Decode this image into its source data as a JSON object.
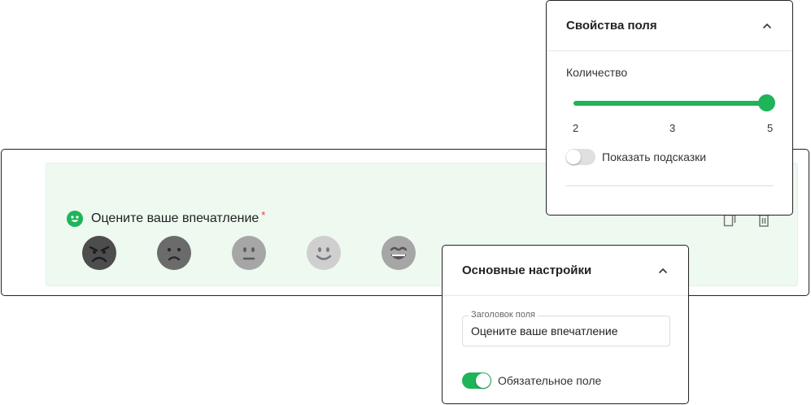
{
  "field": {
    "title": "Оцените ваше впечатление",
    "required_mark": "*",
    "icon": "smiley-badge-icon",
    "accent_color": "#1fb45a"
  },
  "emojis": [
    {
      "name": "angry-face-icon",
      "color": "#4d4d4d"
    },
    {
      "name": "sad-face-icon",
      "color": "#6b6b6b"
    },
    {
      "name": "neutral-face-icon",
      "color": "#a6a6a6"
    },
    {
      "name": "smile-face-icon",
      "color": "#cfcfcf"
    },
    {
      "name": "grin-face-icon",
      "color": "#a6a6a6"
    }
  ],
  "actions": [
    "copy-icon",
    "trash-icon"
  ],
  "props_panel": {
    "title": "Свойства поля",
    "quantity_label": "Количество",
    "slider": {
      "min": 2,
      "mid": 3,
      "max": 5,
      "value": 5,
      "ticks": [
        "2",
        "3",
        "5"
      ]
    },
    "hints_label": "Показать подсказки",
    "hints_enabled": false
  },
  "basic_panel": {
    "title": "Основные настройки",
    "field_title_legend": "Заголовок поля",
    "field_title_value": "Оцените ваше впечатление",
    "required_label": "Обязательное поле",
    "required_enabled": true
  }
}
